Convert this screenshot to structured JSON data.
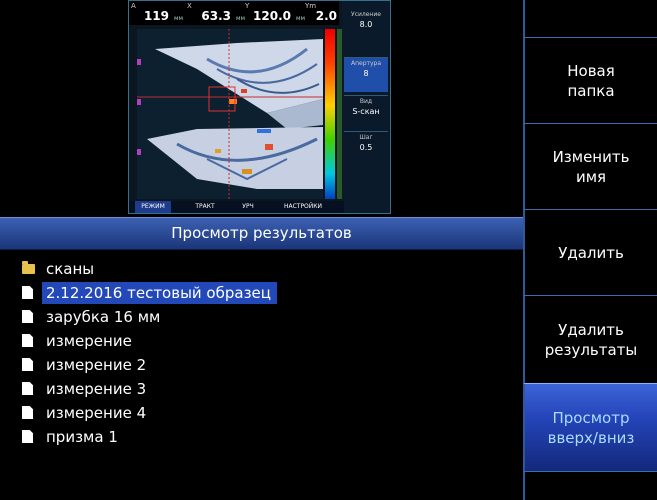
{
  "thumbnail": {
    "readouts": [
      {
        "label": "A",
        "value": "119",
        "unit": "мм"
      },
      {
        "label": "X",
        "value": "63.3",
        "unit": "мм"
      },
      {
        "label": "Y",
        "value": "120.0",
        "unit": "мм"
      },
      {
        "label": "Ym",
        "value": "2.0",
        "unit": ""
      }
    ],
    "side": {
      "gain_label": "Усиление",
      "gain_value": "8.0",
      "aperture_label": "Апертура",
      "aperture_value": "8",
      "view_label": "Вид",
      "view_value": "S-скан",
      "step_label": "Шаг",
      "step_value": "0.5"
    },
    "tabs": [
      "РЕЖИМ",
      "ТРАКТ",
      "УРЧ",
      "НАСТРОЙКИ"
    ]
  },
  "title": "Просмотр результатов",
  "files": [
    {
      "name": "сканы",
      "type": "folder",
      "selected": false
    },
    {
      "name": "2.12.2016 тестовый образец",
      "type": "file",
      "selected": true
    },
    {
      "name": "зарубка 16 мм",
      "type": "file",
      "selected": false
    },
    {
      "name": "измерение",
      "type": "file",
      "selected": false
    },
    {
      "name": "измерение 2",
      "type": "file",
      "selected": false
    },
    {
      "name": "измерение 3",
      "type": "file",
      "selected": false
    },
    {
      "name": "измерение 4",
      "type": "file",
      "selected": false
    },
    {
      "name": "призма 1",
      "type": "file",
      "selected": false
    }
  ],
  "menu": [
    {
      "label": "",
      "active": false
    },
    {
      "label": "Новая\nпапка",
      "active": false
    },
    {
      "label": "Изменить\nимя",
      "active": false
    },
    {
      "label": "Удалить",
      "active": false
    },
    {
      "label": "Удалить\nрезультаты",
      "active": false
    },
    {
      "label": "Просмотр\nвверх/вниз",
      "active": true
    },
    {
      "label": "",
      "active": false
    }
  ],
  "colors": {
    "selection": "#2349b8",
    "title_bar": "#2b4b96",
    "active_button": "#2444b8"
  }
}
